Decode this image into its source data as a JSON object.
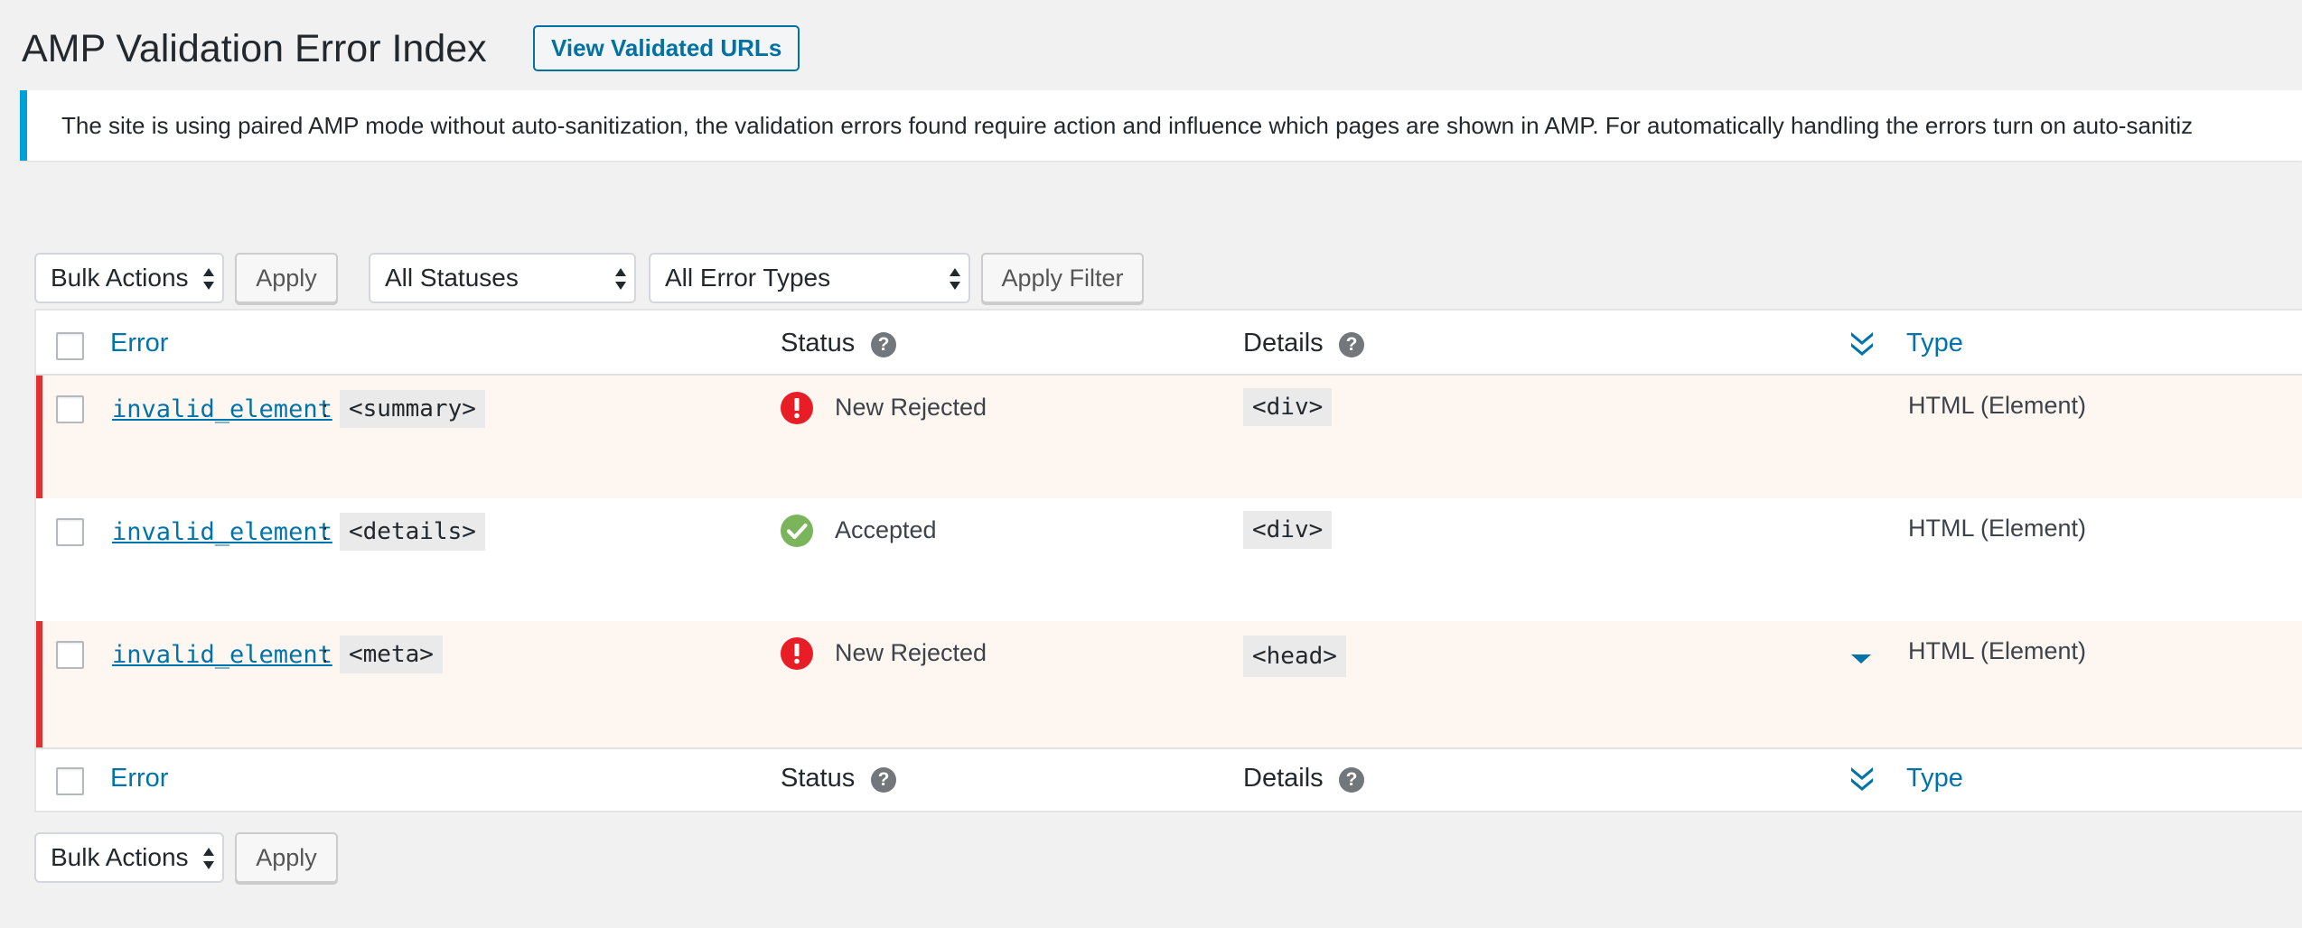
{
  "page": {
    "title": "AMP Validation Error Index",
    "view_validated_label": "View Validated URLs"
  },
  "notice": {
    "text": "The site is using paired AMP mode without auto-sanitization, the validation errors found require action and influence which pages are shown in AMP. For automatically handling the errors turn on auto-sanitiz"
  },
  "top_toolbar": {
    "bulk_actions": "Bulk Actions",
    "apply": "Apply",
    "status_filter": "All Statuses",
    "type_filter": "All Error Types",
    "apply_filter": "Apply Filter"
  },
  "bottom_toolbar": {
    "bulk_actions": "Bulk Actions",
    "apply": "Apply"
  },
  "columns": {
    "error": "Error",
    "status": "Status",
    "details": "Details",
    "type": "Type",
    "help": "?"
  },
  "rows": [
    {
      "code": "invalid_element",
      "separator": ":",
      "tag": "<summary>",
      "status": "New Rejected",
      "details": "<div>",
      "type": "HTML (Element)"
    },
    {
      "code": "invalid_element",
      "separator": ":",
      "tag": "<details>",
      "status": "Accepted",
      "details": "<div>",
      "type": "HTML (Element)"
    },
    {
      "code": "invalid_element",
      "separator": ":",
      "tag": "<meta>",
      "status": "New Rejected",
      "details": "<head>",
      "type": "HTML (Element)"
    }
  ],
  "colors": {
    "link": "#0073aa",
    "rejected_bar": "#dc3232",
    "rejected_row_bg": "#fef7f1",
    "accepted_icon": "#7ab55c",
    "rejected_icon": "#e91d25",
    "notice_border": "#00a0d2"
  },
  "icons": {
    "rejected": "exclamation-circle-icon",
    "accepted": "check-circle-icon",
    "sort": "double-chevron-down-icon",
    "expand": "caret-down-icon",
    "help": "question-circle-icon",
    "select_arrows": "up-down-arrows-icon"
  }
}
